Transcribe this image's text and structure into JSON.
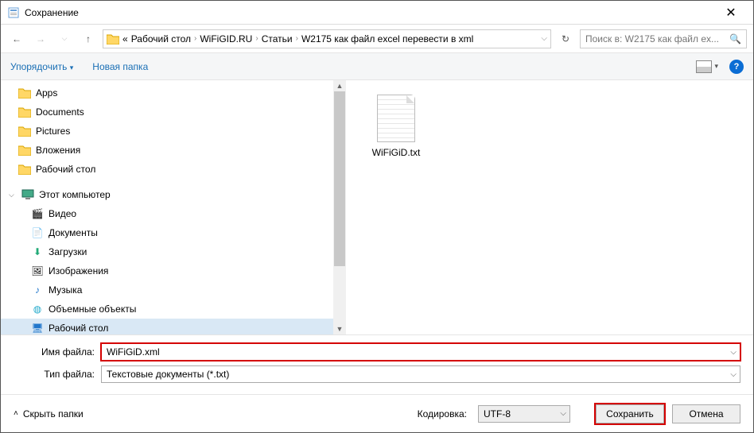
{
  "window": {
    "title": "Сохранение"
  },
  "breadcrumb": [
    "Рабочий стол",
    "WiFiGID.RU",
    "Статьи",
    "W2175 как файл excel перевести в xml"
  ],
  "breadcrumb_prefix": "«",
  "search": {
    "placeholder": "Поиск в: W2175 как файл ex..."
  },
  "toolbar": {
    "organize": "Упорядочить",
    "newfolder": "Новая папка"
  },
  "tree": {
    "top": [
      {
        "label": "Apps"
      },
      {
        "label": "Documents"
      },
      {
        "label": "Pictures"
      },
      {
        "label": "Вложения"
      },
      {
        "label": "Рабочий стол"
      }
    ],
    "pc_label": "Этот компьютер",
    "pc_children": [
      {
        "label": "Видео",
        "icon": "video"
      },
      {
        "label": "Документы",
        "icon": "doc"
      },
      {
        "label": "Загрузки",
        "icon": "download"
      },
      {
        "label": "Изображения",
        "icon": "image"
      },
      {
        "label": "Музыка",
        "icon": "music"
      },
      {
        "label": "Объемные объекты",
        "icon": "cube"
      },
      {
        "label": "Рабочий стол",
        "icon": "desktop",
        "selected": true
      }
    ]
  },
  "content": {
    "file": "WiFiGiD.txt"
  },
  "form": {
    "filename_label": "Имя файла:",
    "filename_value": "WiFiGiD.xml",
    "filetype_label": "Тип файла:",
    "filetype_value": "Текстовые документы (*.txt)"
  },
  "footer": {
    "hide": "Скрыть папки",
    "encoding_label": "Кодировка:",
    "encoding_value": "UTF-8",
    "save": "Сохранить",
    "cancel": "Отмена"
  }
}
